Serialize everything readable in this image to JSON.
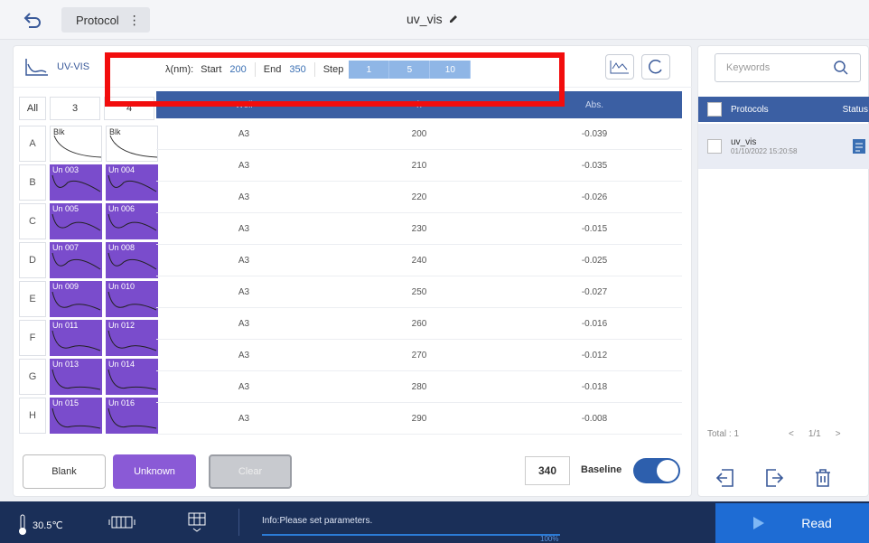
{
  "header": {
    "protocol_label": "Protocol",
    "menu_glyph": "⋮",
    "title": "uv_vis"
  },
  "toolbar": {
    "mode": "UV-VIS",
    "lambda_label": "λ(nm):",
    "start_label": "Start",
    "start_value": "200",
    "end_label": "End",
    "end_value": "350",
    "step_label": "Step",
    "steps": [
      "1",
      "5",
      "10"
    ]
  },
  "plate": {
    "all_label": "All",
    "col_3": "3",
    "col_4": "4",
    "rows": [
      {
        "label": "A",
        "w1": "Blk",
        "w2": "Blk",
        "type": "blank"
      },
      {
        "label": "B",
        "w1": "Un 003",
        "w2": "Un 004",
        "type": "sample"
      },
      {
        "label": "C",
        "w1": "Un 005",
        "w2": "Un 006",
        "type": "sample"
      },
      {
        "label": "D",
        "w1": "Un 007",
        "w2": "Un 008",
        "type": "sample"
      },
      {
        "label": "E",
        "w1": "Un 009",
        "w2": "Un 010",
        "type": "sample"
      },
      {
        "label": "F",
        "w1": "Un 011",
        "w2": "Un 012",
        "type": "sample"
      },
      {
        "label": "G",
        "w1": "Un 013",
        "w2": "Un 014",
        "type": "sample"
      },
      {
        "label": "H",
        "w1": "Un 015",
        "w2": "Un 016",
        "type": "sample"
      }
    ]
  },
  "table": {
    "columns": [
      "Well",
      "λ",
      "Abs."
    ],
    "rows": [
      [
        "A3",
        "200",
        "-0.039"
      ],
      [
        "A3",
        "210",
        "-0.035"
      ],
      [
        "A3",
        "220",
        "-0.026"
      ],
      [
        "A3",
        "230",
        "-0.015"
      ],
      [
        "A3",
        "240",
        "-0.025"
      ],
      [
        "A3",
        "250",
        "-0.027"
      ],
      [
        "A3",
        "260",
        "-0.016"
      ],
      [
        "A3",
        "270",
        "-0.012"
      ],
      [
        "A3",
        "280",
        "-0.018"
      ],
      [
        "A3",
        "290",
        "-0.008"
      ]
    ]
  },
  "actions": {
    "blank": "Blank",
    "unknown": "Unknown",
    "clear": "Clear",
    "wavelength": "340",
    "baseline": "Baseline"
  },
  "sidebar": {
    "search_placeholder": "Keywords",
    "col_protocols": "Protocols",
    "col_status": "Status",
    "item_name": "uv_vis",
    "item_date": "01/10/2022 15:20:58",
    "total": "Total : 1",
    "page": "1/1",
    "prev": "<",
    "next": ">"
  },
  "status": {
    "temperature": "30.5℃",
    "info": "Info:Please set parameters.",
    "progress": "100%",
    "read": "Read"
  },
  "colors": {
    "accent": "#3b5fa3",
    "sample": "#7a4ccc",
    "read": "#1e6cd4",
    "highlight": "#f20d0d"
  }
}
